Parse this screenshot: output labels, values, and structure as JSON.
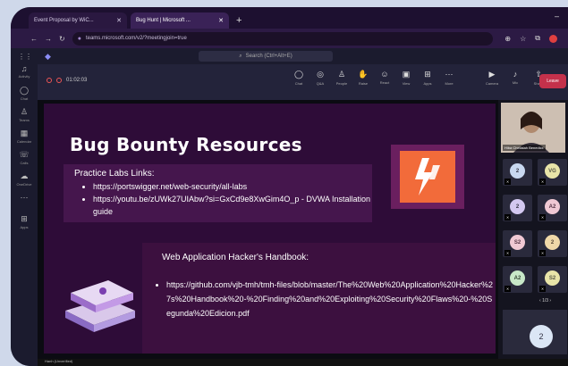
{
  "browser": {
    "tabs": [
      {
        "label": "Event Proposal by WiC...",
        "active": false
      },
      {
        "label": "Bug Hunt | Microsoft ...",
        "active": true
      }
    ],
    "url": "teams.microsoft.com/v2/?meetingjoin=true"
  },
  "teams": {
    "search_placeholder": "Search (Ctrl+Alt+E)",
    "rail": [
      {
        "icon": "bell-icon",
        "label": "Activity"
      },
      {
        "icon": "chat-icon",
        "label": "Chat"
      },
      {
        "icon": "teams-icon",
        "label": "Teams"
      },
      {
        "icon": "calendar-icon",
        "label": "Calendar"
      },
      {
        "icon": "phone-icon",
        "label": "Calls"
      },
      {
        "icon": "cloud-icon",
        "label": "OneDrive"
      },
      {
        "icon": "more-icon",
        "label": ""
      },
      {
        "icon": "apps-icon",
        "label": "Apps"
      }
    ],
    "meeting": {
      "timer": "01:02:03",
      "toolbar": [
        {
          "icon": "chat-icon",
          "label": "Chat"
        },
        {
          "icon": "people-icon",
          "label": "Q&A"
        },
        {
          "icon": "people-icon",
          "label": "People"
        },
        {
          "icon": "raise-hand-icon",
          "label": "Raise"
        },
        {
          "icon": "react-icon",
          "label": "React"
        },
        {
          "icon": "view-icon",
          "label": "View"
        },
        {
          "icon": "apps-icon",
          "label": "Apps"
        },
        {
          "icon": "more-icon",
          "label": "More"
        }
      ],
      "controls": [
        {
          "icon": "camera-icon",
          "label": "Camera"
        },
        {
          "icon": "mic-icon",
          "label": "Mic"
        },
        {
          "icon": "share-icon",
          "label": "Share"
        }
      ],
      "leave_label": "Leave"
    },
    "status_text": "Hanh (Unverified)"
  },
  "slide": {
    "title": "Bug Bounty Resources",
    "practice_heading": "Practice Labs Links:",
    "practice_links": [
      "https://portswigger.net/web-security/all-labs",
      "https://youtu.be/zUWk27UIAbw?si=GxCd9e8XwGim4O_p - DVWA Installation guide"
    ],
    "handbook_heading": "Web Application Hacker's Handbook:",
    "handbook_links": [
      "https://github.com/vjb-tmh/tmh-files/blob/master/The%20Web%20Application%20Hacker%27s%20Handbook%20-%20Finding%20and%20Exploiting%20Security%20Flaws%20-%20Segunda%20Edicion.pdf"
    ]
  },
  "participants": {
    "self_name": "Hiba Chellaiah Benedicx",
    "tiles": [
      {
        "initials": "2",
        "color": "#c9d8f0"
      },
      {
        "initials": "VG",
        "color": "#e8e4a8"
      },
      {
        "initials": "2",
        "color": "#d3c8f0"
      },
      {
        "initials": "A2",
        "color": "#f0c8d3"
      },
      {
        "initials": "S2",
        "color": "#f0c8d3"
      },
      {
        "initials": "2",
        "color": "#f0d8a8"
      },
      {
        "initials": "A2",
        "color": "#c8e8c8"
      },
      {
        "initials": "S2",
        "color": "#e8e4a8"
      }
    ],
    "page": "1/3",
    "featured_initials": "2"
  }
}
